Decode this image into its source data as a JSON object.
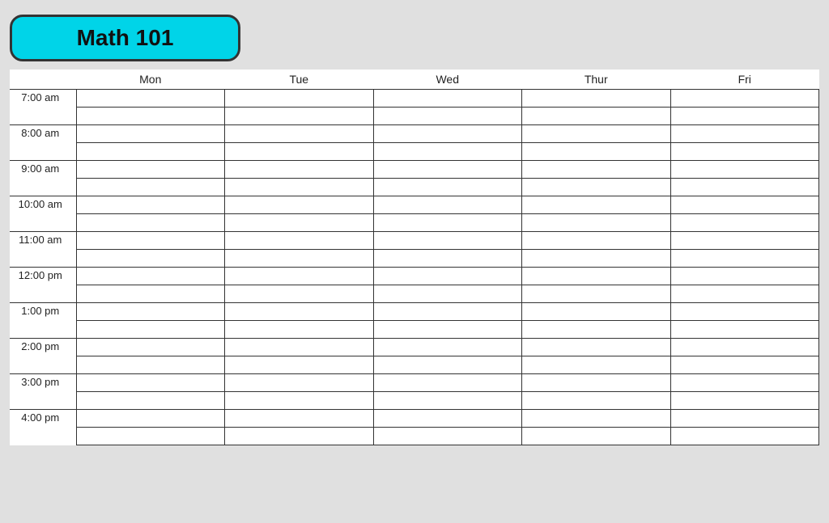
{
  "title": "Math 101",
  "days": [
    "Mon",
    "Tue",
    "Wed",
    "Thur",
    "Fri"
  ],
  "times": [
    "7:00 am",
    "8:00 am",
    "9:00 am",
    "10:00 am",
    "11:00 am",
    "12:00 pm",
    "1:00 pm",
    "2:00 pm",
    "3:00 pm",
    "4:00 pm"
  ],
  "colors": {
    "badge_bg": "#00d4e8",
    "badge_border": "#333"
  }
}
